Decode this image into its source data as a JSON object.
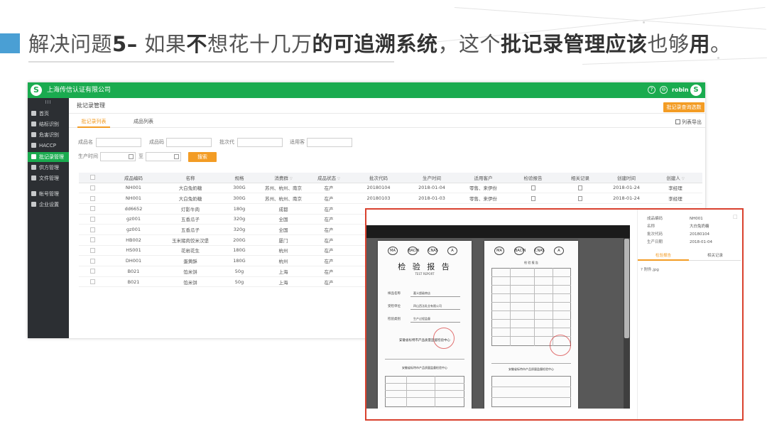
{
  "slide": {
    "title_parts": [
      "解决问题",
      "5–",
      " 如果",
      "不",
      "想花十几万",
      "的可追溯系统",
      "，这个",
      "批记录管理应该",
      "也够",
      "用",
      "。"
    ]
  },
  "app": {
    "company": "上海传信认证有限公司",
    "user": "robin",
    "logo_letter": "S",
    "user_initial": "S",
    "header_icons": [
      "?",
      "⊖"
    ]
  },
  "sidebar": {
    "collapse": "III",
    "items": [
      {
        "label": "首页",
        "icon": "monitor-icon"
      },
      {
        "label": "结标识别",
        "icon": "gear-icon"
      },
      {
        "label": "危害识别",
        "icon": "user-icon"
      },
      {
        "label": "HACCP",
        "icon": "shield-icon"
      },
      {
        "label": "批记录管理",
        "icon": "shield-icon",
        "active": true
      },
      {
        "label": "供方管理",
        "icon": "cart-icon"
      },
      {
        "label": "文件管理",
        "icon": "folder-icon"
      },
      {
        "label": "帐号管理",
        "icon": "user-icon"
      },
      {
        "label": "企业设置",
        "icon": "home-icon"
      }
    ]
  },
  "page": {
    "title": "批记录管理",
    "action_button": "批记录查询选数",
    "tabs": [
      "批记录列表",
      "成品列表"
    ],
    "export": "列表导出"
  },
  "filters": {
    "labels": [
      "成品名",
      "成品码",
      "批次代",
      "适用客",
      "生产时间",
      "至"
    ],
    "search_button": "搜索"
  },
  "table": {
    "headers": [
      "成品编码",
      "名称",
      "规格",
      "消费群",
      "成品状态",
      "批次代码",
      "生产时间",
      "适用客户",
      "检验报告",
      "相关记录",
      "创建时间",
      "创建人"
    ],
    "rows": [
      [
        "NH001",
        "大白兔奶糖",
        "300G",
        "苏州、杭州、南京",
        "在产",
        "20180104",
        "2018-01-04",
        "零售、来伊份",
        "doc",
        "doc",
        "2018-01-24",
        "李经理"
      ],
      [
        "NH001",
        "大白兔奶糖",
        "300G",
        "苏州、杭州、南京",
        "在产",
        "20180103",
        "2018-01-03",
        "零售、来伊份",
        "doc",
        "doc",
        "2018-01-24",
        "李经理"
      ],
      [
        "dd6652",
        "灯影牛肉",
        "180g",
        "成都",
        "在产",
        "",
        "",
        "",
        "",
        "",
        "",
        ""
      ],
      [
        "gz001",
        "五香瓜子",
        "320g",
        "全国",
        "在产",
        "",
        "",
        "",
        "",
        "",
        "",
        ""
      ],
      [
        "gz001",
        "五香瓜子",
        "320g",
        "全国",
        "在产",
        "",
        "",
        "",
        "",
        "",
        "",
        ""
      ],
      [
        "HB002",
        "玉米猪肉饺米汉堡",
        "200G",
        "厦门",
        "在产",
        "",
        "",
        "",
        "",
        "",
        "",
        ""
      ],
      [
        "HS001",
        "花岩花生",
        "180G",
        "杭州",
        "在产",
        "",
        "",
        "",
        "",
        "",
        "",
        ""
      ],
      [
        "DH001",
        "蛋黄酥",
        "180G",
        "杭州",
        "在产",
        "",
        "",
        "",
        "",
        "",
        "",
        ""
      ],
      [
        "B021",
        "馅米饼",
        "50g",
        "上海",
        "在产",
        "",
        "",
        "",
        "",
        "",
        "",
        ""
      ],
      [
        "B021",
        "馅米饼",
        "50g",
        "上海",
        "在产",
        "",
        "",
        "",
        "",
        "",
        "",
        ""
      ]
    ]
  },
  "preview": {
    "doc": {
      "logos_left": [
        "MA",
        "BACIN",
        "CNAS",
        "A"
      ],
      "logos_right": [
        "MA",
        "BACIN",
        "CNAS",
        "A"
      ],
      "heading": "检 验 报 告",
      "subheading": "TEST  REPORT",
      "field_labels": [
        "样品名称",
        "受检单位",
        "检验类别"
      ],
      "field_values": [
        "嘉义超级商店",
        "四山西法乳业有限公司",
        "生产过程监督"
      ],
      "org": "安徽省标特市产品质量监督检验中心",
      "right_title": "检 验 报 告",
      "bottom_org": "安徽省标特市产品质量监督检验中心"
    },
    "info": [
      {
        "k": "成品编码",
        "v": "NH001"
      },
      {
        "k": "名称",
        "v": "大白兔奶糖"
      },
      {
        "k": "批次代码",
        "v": "20180104"
      },
      {
        "k": "生产日期",
        "v": "2018-01-04"
      }
    ],
    "tabs": [
      "检验报告",
      "相关记录"
    ],
    "file": "? 附件.jpg"
  },
  "colors": {
    "brand": "#1aab4f",
    "accent": "#f39c24",
    "sidebar": "#2c2f33",
    "slide_marker": "#4a9fd4",
    "highlight_border": "#d9412e"
  }
}
